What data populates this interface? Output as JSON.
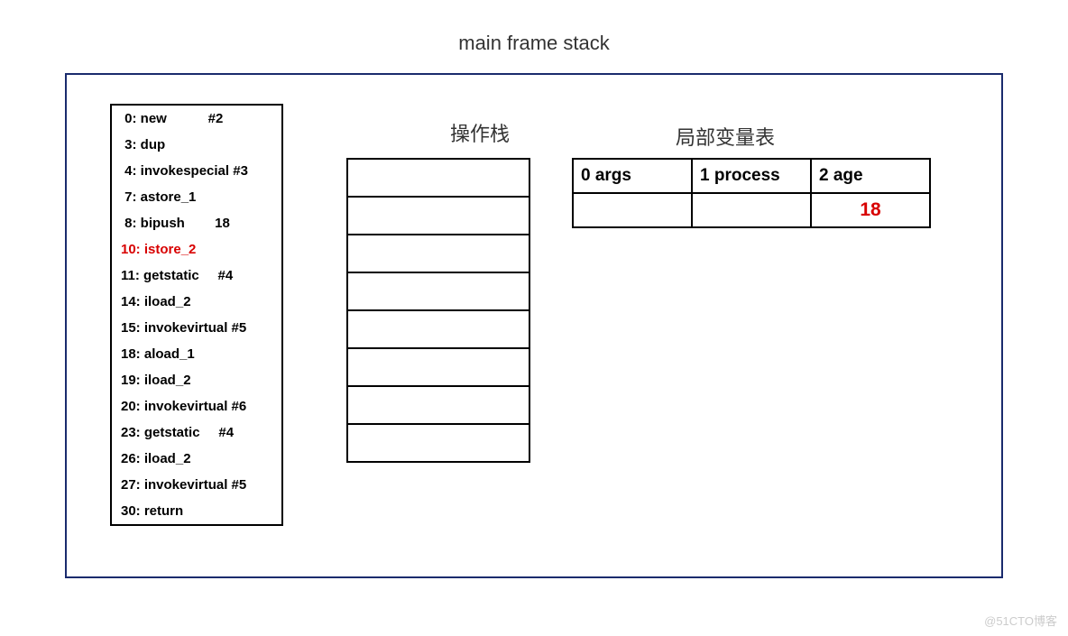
{
  "title": "main frame stack",
  "bytecode": {
    "lines": [
      {
        "text": " 0: new           #2",
        "highlighted": false
      },
      {
        "text": " 3: dup",
        "highlighted": false
      },
      {
        "text": " 4: invokespecial #3",
        "highlighted": false
      },
      {
        "text": " 7: astore_1",
        "highlighted": false
      },
      {
        "text": " 8: bipush        18",
        "highlighted": false
      },
      {
        "text": "10: istore_2",
        "highlighted": true
      },
      {
        "text": "11: getstatic     #4",
        "highlighted": false
      },
      {
        "text": "14: iload_2",
        "highlighted": false
      },
      {
        "text": "15: invokevirtual #5",
        "highlighted": false
      },
      {
        "text": "18: aload_1",
        "highlighted": false
      },
      {
        "text": "19: iload_2",
        "highlighted": false
      },
      {
        "text": "20: invokevirtual #6",
        "highlighted": false
      },
      {
        "text": "23: getstatic     #4",
        "highlighted": false
      },
      {
        "text": "26: iload_2",
        "highlighted": false
      },
      {
        "text": "27: invokevirtual #5",
        "highlighted": false
      },
      {
        "text": "30: return",
        "highlighted": false
      }
    ]
  },
  "operandStack": {
    "title": "操作栈",
    "cells": [
      "",
      "",
      "",
      "",
      "",
      "",
      "",
      ""
    ]
  },
  "locals": {
    "title": "局部变量表",
    "headers": [
      "0 args",
      "1 process",
      "2 age"
    ],
    "values": [
      "",
      "",
      "18"
    ]
  },
  "watermark": "@51CTO博客"
}
